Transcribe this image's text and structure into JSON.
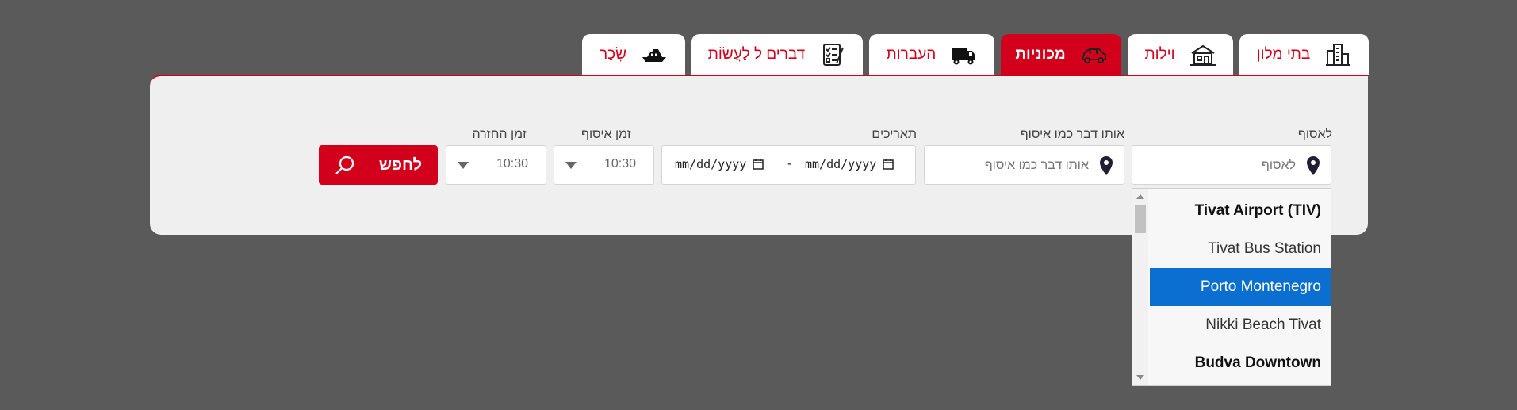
{
  "tabs": [
    {
      "label": "בתי מלון",
      "icon": "buildings-icon"
    },
    {
      "label": "וילות",
      "icon": "villa-icon"
    },
    {
      "label": "מכוניות",
      "icon": "car-icon"
    },
    {
      "label": "העברות",
      "icon": "van-icon"
    },
    {
      "label": "דברים ל לַעֲשׂוֹת",
      "icon": "checklist-icon"
    },
    {
      "label": "שְׂכַר",
      "icon": "yacht-icon"
    }
  ],
  "active_tab": "מכוניות",
  "form": {
    "pickup": {
      "label": "לאסוף",
      "placeholder": "לאסוף"
    },
    "dropoff": {
      "label": "אותו דבר כמו איסוף",
      "placeholder": "אותו דבר כמו איסוף"
    },
    "dates": {
      "label": "תאריכים",
      "start": "mm/dd/yyyy",
      "separator": "-",
      "end": "mm/dd/yyyy"
    },
    "pickup_time": {
      "label": "זמן איסוף",
      "value": "10:30"
    },
    "return_time": {
      "label": "זמן החזרה",
      "value": "10:30"
    },
    "search_label": "לחפש"
  },
  "dropdown": {
    "items": [
      {
        "label": "Tivat Airport (TIV)",
        "bold": true
      },
      {
        "label": "Tivat Bus Station",
        "bold": false
      },
      {
        "label": "Porto Montenegro",
        "bold": false,
        "selected": true
      },
      {
        "label": "Nikki Beach Tivat",
        "bold": false
      },
      {
        "label": "Budva Downtown",
        "bold": true
      }
    ]
  },
  "colors": {
    "brand_red": "#d3001b",
    "background": "#5a5a5a",
    "panel": "#efefef",
    "selection_blue": "#0a6fd0"
  }
}
